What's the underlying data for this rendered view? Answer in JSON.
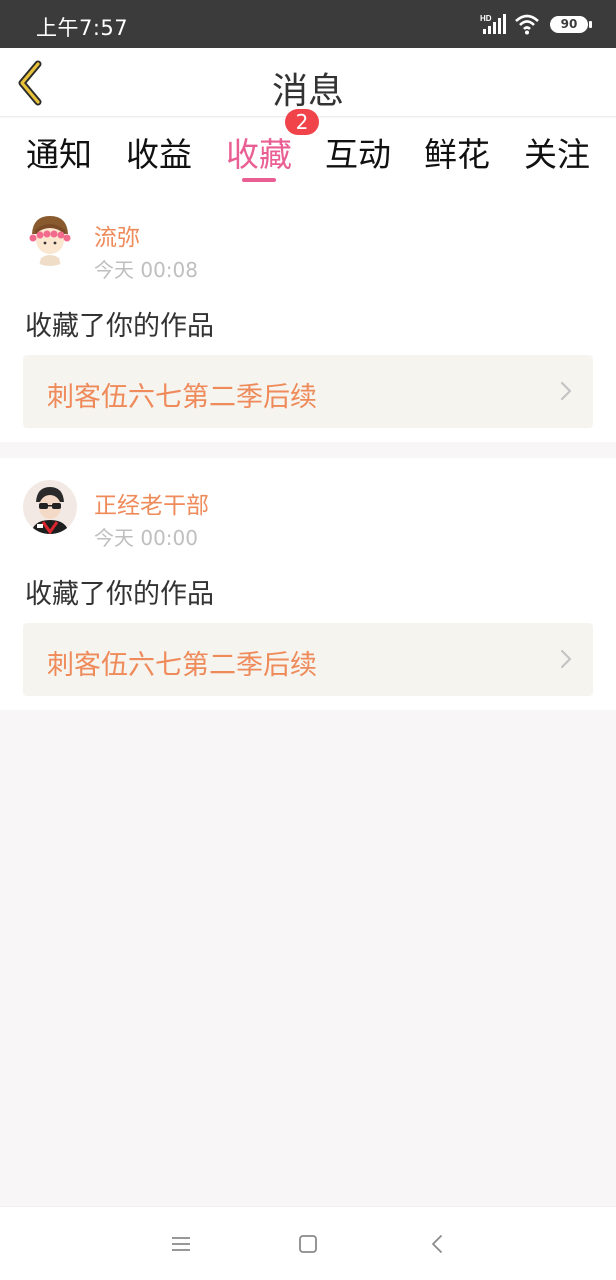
{
  "status_bar": {
    "time": "上午7:57",
    "hd_label": "HD",
    "battery": "90"
  },
  "header": {
    "title": "消息",
    "back_icon": "chevron-left-icon"
  },
  "tabs": [
    {
      "label": "通知",
      "active": false
    },
    {
      "label": "收益",
      "active": false
    },
    {
      "label": "收藏",
      "active": true,
      "badge": "2"
    },
    {
      "label": "互动",
      "active": false
    },
    {
      "label": "鲜花",
      "active": false
    },
    {
      "label": "关注",
      "active": false
    }
  ],
  "notifications": [
    {
      "username": "流弥",
      "time": "今天 00:08",
      "action": "收藏了你的作品",
      "work_title": "刺客伍六七第二季后续"
    },
    {
      "username": "正经老干部",
      "time": "今天 00:00",
      "action": "收藏了你的作品",
      "work_title": "刺客伍六七第二季后续"
    }
  ],
  "colors": {
    "accent": "#ea5f93",
    "username": "#ef8a5a",
    "badge": "#f0444a",
    "back_arrow": "#e8c23a"
  },
  "nav": {
    "menu_icon": "menu-icon",
    "home_icon": "square-home-icon",
    "back_icon": "back-triangle-icon"
  }
}
